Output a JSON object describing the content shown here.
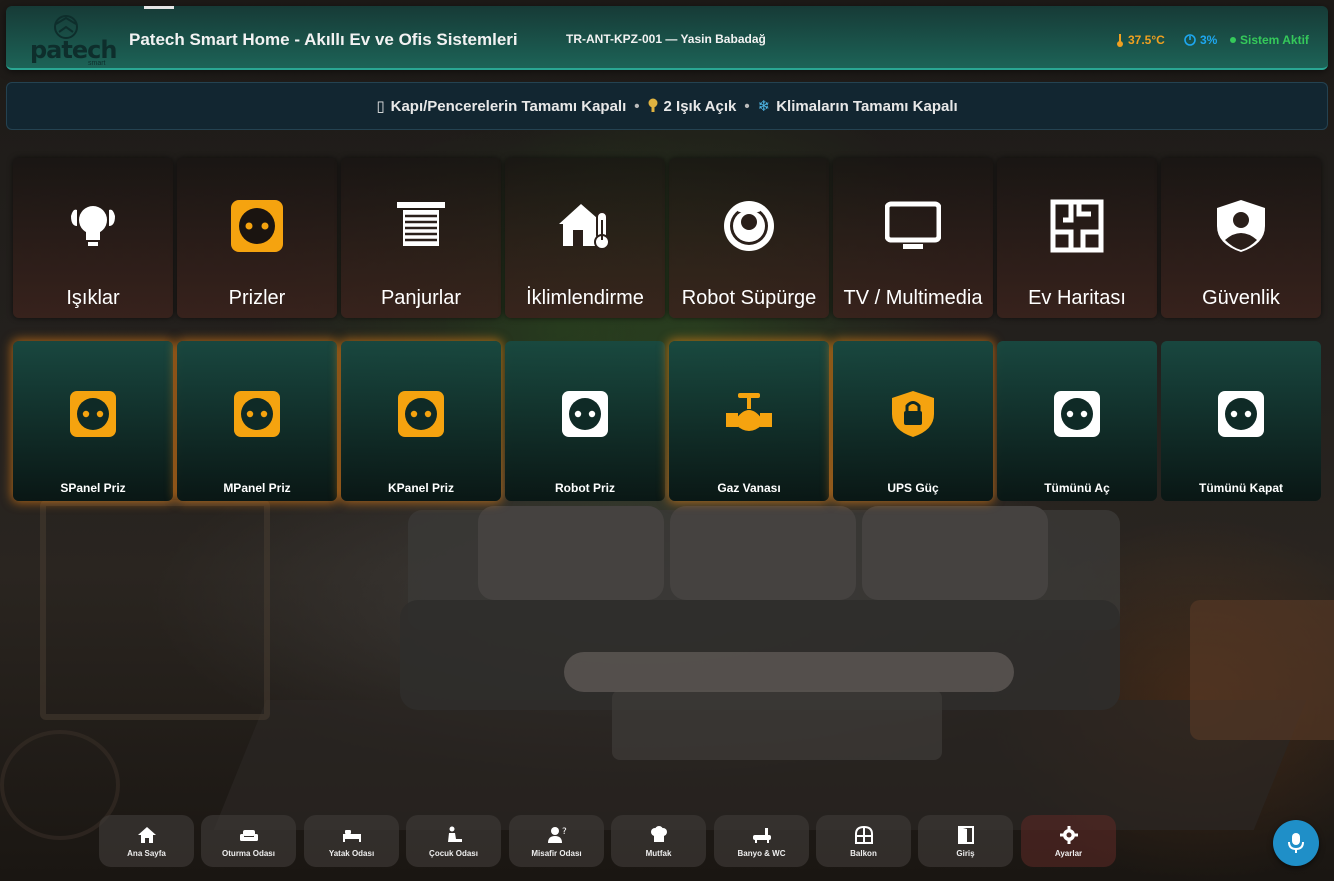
{
  "header": {
    "logo_text": "patech",
    "logo_sub": "smart",
    "title": "Patech Smart Home - Akıllı Ev ve Ofis Sistemleri",
    "device": "TR-ANT-KPZ-001 — Yasin Babadağ",
    "temperature": "37.5°C",
    "humidity": "3%",
    "system_status": "Sistem Aktif",
    "colors": {
      "temperature": "#f0a020",
      "humidity": "#1ea7f0",
      "system": "#35c95a",
      "accent": "#2aa693"
    }
  },
  "status_bar": {
    "doors": "Kapı/Pencerelerin Tamamı Kapalı",
    "lights": "2 Işık Açık",
    "climate": "Klimaların Tamamı Kapalı",
    "separator": "•"
  },
  "categories": [
    {
      "label": "Işıklar",
      "icon": "lightbulb-icon"
    },
    {
      "label": "Prizler",
      "icon": "socket-icon"
    },
    {
      "label": "Panjurlar",
      "icon": "blinds-icon"
    },
    {
      "label": "İklimlendirme",
      "icon": "home-thermometer-icon"
    },
    {
      "label": "Robot Süpürge",
      "icon": "robot-vacuum-icon"
    },
    {
      "label": "TV / Multimedia",
      "icon": "tv-icon"
    },
    {
      "label": "Ev Haritası",
      "icon": "floor-plan-icon"
    },
    {
      "label": "Güvenlik",
      "icon": "shield-user-icon"
    }
  ],
  "devices": [
    {
      "label": "SPanel Priz",
      "icon": "socket-icon",
      "on": true
    },
    {
      "label": "MPanel Priz",
      "icon": "socket-icon",
      "on": true
    },
    {
      "label": "KPanel Priz",
      "icon": "socket-icon",
      "on": true
    },
    {
      "label": "Robot Priz",
      "icon": "socket-icon",
      "on": false
    },
    {
      "label": "Gaz Vanası",
      "icon": "valve-icon",
      "on": true
    },
    {
      "label": "UPS Güç",
      "icon": "shield-lock-icon",
      "on": true
    },
    {
      "label": "Tümünü Aç",
      "icon": "socket-icon",
      "on": false
    },
    {
      "label": "Tümünü Kapat",
      "icon": "socket-icon",
      "on": false
    }
  ],
  "nav": [
    {
      "label": "Ana Sayfa",
      "icon": "home-icon"
    },
    {
      "label": "Oturma Odası",
      "icon": "sofa-icon"
    },
    {
      "label": "Yatak Odası",
      "icon": "bed-icon"
    },
    {
      "label": "Çocuk Odası",
      "icon": "child-icon"
    },
    {
      "label": "Misafir Odası",
      "icon": "guest-icon"
    },
    {
      "label": "Mutfak",
      "icon": "chef-hat-icon"
    },
    {
      "label": "Banyo & WC",
      "icon": "bath-icon"
    },
    {
      "label": "Balkon",
      "icon": "window-icon"
    },
    {
      "label": "Giriş",
      "icon": "door-icon"
    },
    {
      "label": "Ayarlar",
      "icon": "gear-icon"
    }
  ],
  "mic": {
    "icon": "microphone-icon",
    "color": "#1f8fc8"
  }
}
